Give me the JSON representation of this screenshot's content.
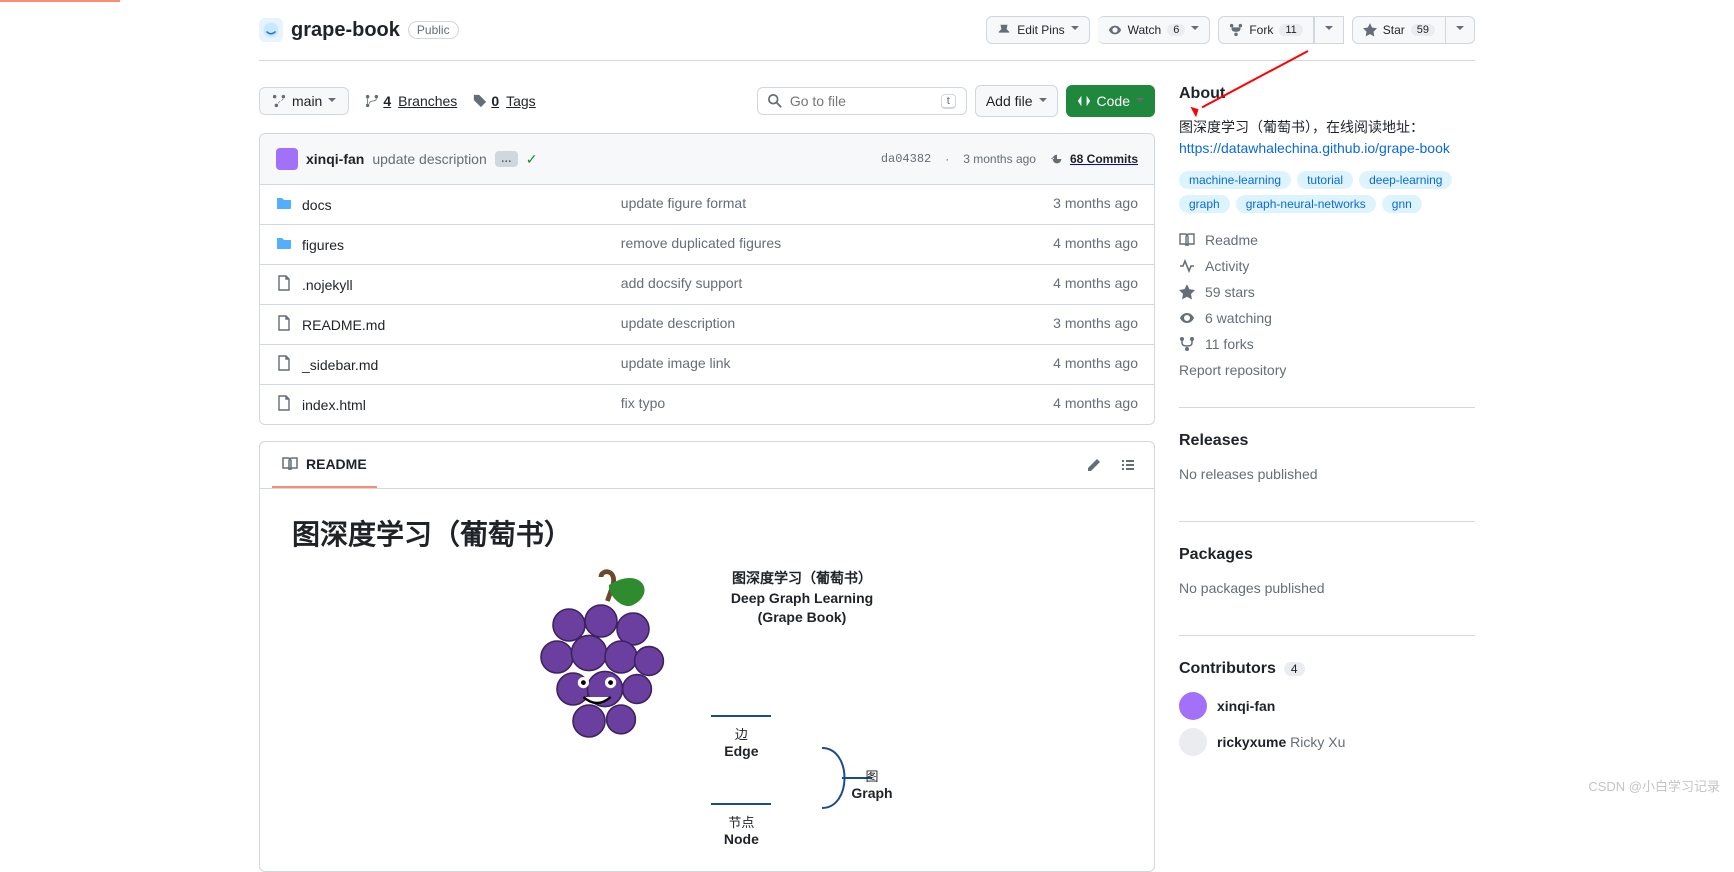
{
  "repo": {
    "name": "grape-book",
    "visibility": "Public"
  },
  "headerActions": {
    "editPins": "Edit Pins",
    "watch": {
      "label": "Watch",
      "count": "6"
    },
    "fork": {
      "label": "Fork",
      "count": "11"
    },
    "star": {
      "label": "Star",
      "count": "59"
    }
  },
  "branch": {
    "name": "main"
  },
  "branches": {
    "count": "4",
    "label": "Branches"
  },
  "tags": {
    "count": "0",
    "label": "Tags"
  },
  "search": {
    "placeholder": "Go to file",
    "hint": "t"
  },
  "addFile": "Add file",
  "codeBtn": "Code",
  "latestCommit": {
    "author": "xinqi-fan",
    "message": "update description",
    "sha": "da04382",
    "age": "3 months ago",
    "commitsCount": "68 Commits"
  },
  "files": [
    {
      "type": "dir",
      "name": "docs",
      "msg": "update figure format",
      "time": "3 months ago"
    },
    {
      "type": "dir",
      "name": "figures",
      "msg": "remove duplicated figures",
      "time": "4 months ago"
    },
    {
      "type": "file",
      "name": ".nojekyll",
      "msg": "add docsify support",
      "time": "4 months ago"
    },
    {
      "type": "file",
      "name": "README.md",
      "msg": "update description",
      "time": "3 months ago"
    },
    {
      "type": "file",
      "name": "_sidebar.md",
      "msg": "update image link",
      "time": "4 months ago"
    },
    {
      "type": "file",
      "name": "index.html",
      "msg": "fix typo",
      "time": "4 months ago"
    }
  ],
  "readmeTab": "README",
  "readmeTitle": "图深度学习（葡萄书）",
  "readmeFig": {
    "title_cn": "图深度学习（葡萄书）",
    "title_en1": "Deep Graph Learning",
    "title_en2": "(Grape Book)",
    "edge_cn": "边",
    "edge_en": "Edge",
    "node_cn": "节点",
    "node_en": "Node",
    "graph_cn": "图",
    "graph_en": "Graph"
  },
  "about": {
    "heading": "About",
    "description": "图深度学习（葡萄书），在线阅读地址：",
    "link": "https://datawhalechina.github.io/grape-book",
    "topics": [
      "machine-learning",
      "tutorial",
      "deep-learning",
      "graph",
      "graph-neural-networks",
      "gnn"
    ],
    "links": {
      "readme": "Readme",
      "activity": "Activity",
      "stars": "59 stars",
      "watching": "6 watching",
      "forks": "11 forks",
      "report": "Report repository"
    }
  },
  "releases": {
    "heading": "Releases",
    "text": "No releases published"
  },
  "packages": {
    "heading": "Packages",
    "text": "No packages published"
  },
  "contributors": {
    "heading": "Contributors",
    "count": "4",
    "list": [
      {
        "login": "xinqi-fan",
        "extra": ""
      },
      {
        "login": "rickyxume",
        "extra": "Ricky Xu"
      }
    ]
  },
  "watermark": "CSDN @小白学习记录"
}
